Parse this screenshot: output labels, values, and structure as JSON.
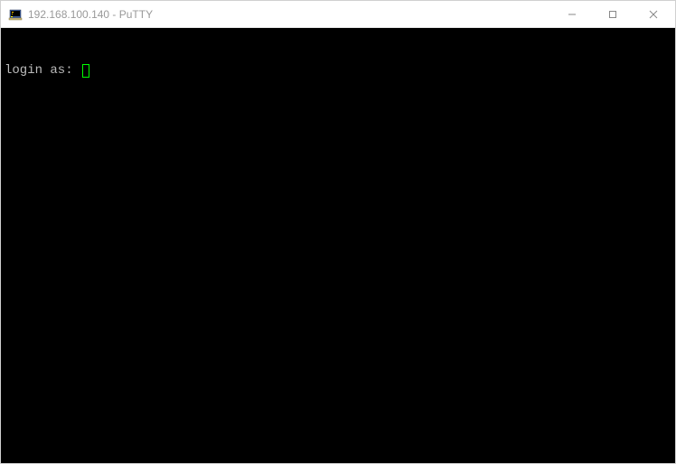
{
  "window": {
    "title": "192.168.100.140 - PuTTY"
  },
  "terminal": {
    "prompt": "login as: "
  }
}
